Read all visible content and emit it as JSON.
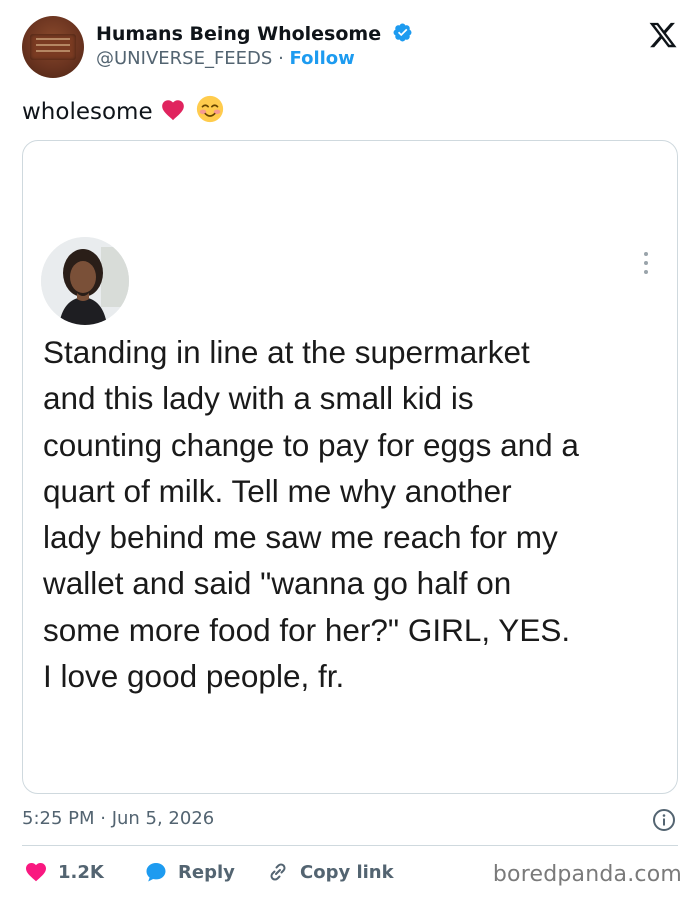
{
  "author": {
    "display_name": "Humans Being Wholesome",
    "handle": "@UNIVERSE_FEEDS",
    "separator": "·",
    "follow_label": "Follow"
  },
  "tweet": {
    "text": "wholesome",
    "emojis": [
      "red-heart-emoji",
      "smiling-face-emoji"
    ]
  },
  "embedded_post": {
    "lines": [
      "Standing in line at the supermarket",
      "and this lady with a small kid is",
      "counting change to pay for eggs and a",
      "quart of milk. Tell me why another",
      "lady behind me saw me reach for my",
      "wallet and said \"wanna go half on",
      "some more food for her?\" GIRL, YES.",
      "I love good people, fr."
    ]
  },
  "meta": {
    "timestamp": "5:25 PM · Jun 5, 2026"
  },
  "actions": {
    "like_count": "1.2K",
    "reply_label": "Reply",
    "copy_link_label": "Copy link"
  },
  "watermark": "boredpanda.com",
  "colors": {
    "accent": "#1d9bf0",
    "like": "#f91880",
    "muted": "#536471",
    "border": "#cfd9de"
  }
}
